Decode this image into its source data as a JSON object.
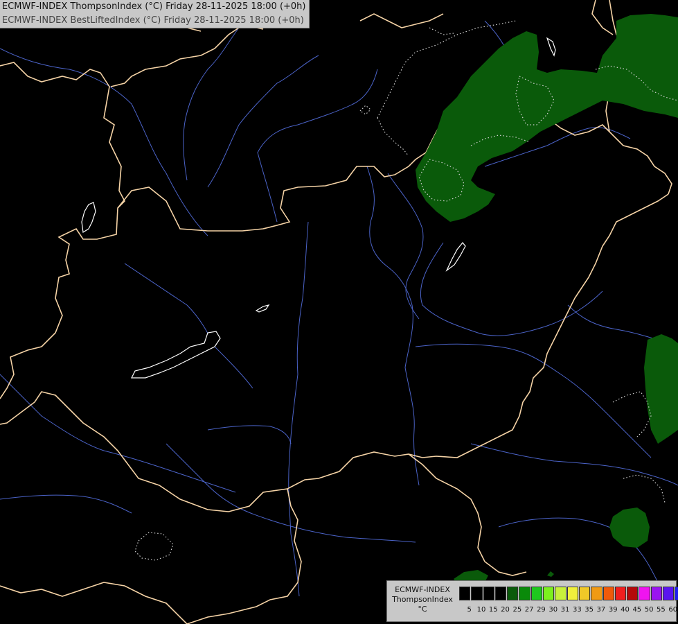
{
  "title": {
    "line1": "ECMWF-INDEX ThompsonIndex (°C) Friday 28-11-2025 18:00 (+0h)",
    "line2": "ECMWF-INDEX BestLiftedIndex (°C) Friday 28-11-2025 18:00 (+0h)"
  },
  "map_colors": {
    "background": "#000000",
    "border": "#f5d3a6",
    "river": "#4b63c8",
    "lake": "#ffffff",
    "fill_green": "#0a5a0a",
    "dotted_contour": "#cfcfcf"
  },
  "legend": {
    "model": "ECMWF-INDEX",
    "param": "ThompsonIndex",
    "unit": "°C",
    "ticks": [
      "5",
      "10",
      "15",
      "20",
      "25",
      "27",
      "29",
      "30",
      "31",
      "33",
      "35",
      "37",
      "39",
      "40",
      "45",
      "50",
      "55",
      "60"
    ],
    "colors": [
      "#000000",
      "#000000",
      "#000000",
      "#000000",
      "#0a5a0a",
      "#0a8a0a",
      "#1ec81e",
      "#7cf01e",
      "#c8f03c",
      "#f0f03c",
      "#f0c828",
      "#f09a14",
      "#f05a0a",
      "#f01e1e",
      "#b40a0a",
      "#f014f0",
      "#9a14f0",
      "#5a14f0",
      "#1e1ef0"
    ]
  }
}
